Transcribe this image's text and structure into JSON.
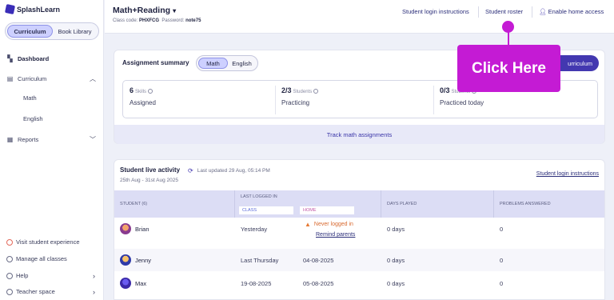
{
  "sidebar": {
    "brand": "SplashLearn",
    "toggle": {
      "left": "Curriculum",
      "right": "Book Library"
    },
    "nav": {
      "dashboard": "Dashboard",
      "curriculum": "Curriculum",
      "math": "Math",
      "english": "English",
      "reports": "Reports"
    },
    "bottom": {
      "visit": "Visit student experience",
      "manage": "Manage all classes",
      "help": "Help",
      "teacher": "Teacher space"
    }
  },
  "header": {
    "class_name": "Math+Reading",
    "class_code_label": "Class code:",
    "class_code": "PHXFCG",
    "password_label": "Password:",
    "password": "note75",
    "links": {
      "login": "Student login instructions",
      "roster": "Student roster",
      "home": "Enable home access"
    }
  },
  "assignment": {
    "title": "Assignment summary",
    "subjects": {
      "math": "Math",
      "english": "English"
    },
    "curriculum_btn": "urriculum",
    "stats": [
      {
        "num": "6",
        "unit": "Skills",
        "label": "Assigned"
      },
      {
        "num": "2/3",
        "unit": "Students",
        "label": "Practicing"
      },
      {
        "num": "0/3",
        "unit": "Students",
        "label": "Practiced today"
      }
    ],
    "track": "Track math assignments"
  },
  "popup": {
    "label": "Click Here",
    "color": "#c41bd4"
  },
  "live": {
    "title": "Student live activity",
    "updated": "Last updated 29 Aug, 05:14 PM",
    "range": "25th Aug - 31st Aug 2025",
    "login_link": "Student login instructions",
    "headers": {
      "student": "STUDENT (6)",
      "last_logged": "LAST LOGGED IN",
      "class": "CLASS",
      "home": "HOME",
      "days": "DAYS PLAYED",
      "problems": "PROBLEMS ANSWERED"
    },
    "never": "Never logged in",
    "remind": "Remind parents",
    "rows": [
      {
        "name": "Brian",
        "class": "Yesterday",
        "home": "",
        "days": "0 days",
        "problems": "0"
      },
      {
        "name": "Jenny",
        "class": "Last Thursday",
        "home": "04-08-2025",
        "days": "0 days",
        "problems": "0"
      },
      {
        "name": "Max",
        "class": "19-08-2025",
        "home": "05-08-2025",
        "days": "0 days",
        "problems": "0"
      }
    ]
  }
}
